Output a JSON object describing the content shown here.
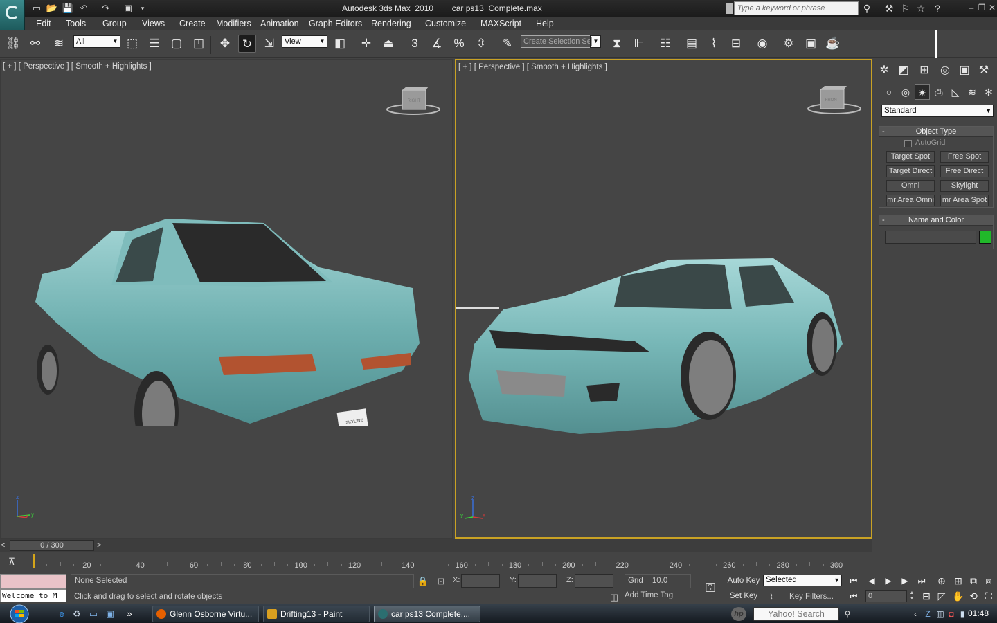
{
  "window": {
    "title": "Autodesk 3ds Max  2010        car ps13  Complete.max",
    "search_placeholder": "Type a keyword or phrase"
  },
  "menu": {
    "items": [
      "Edit",
      "Tools",
      "Group",
      "Views",
      "Create",
      "Modifiers",
      "Animation",
      "Graph Editors",
      "Rendering",
      "Customize",
      "MAXScript",
      "Help"
    ]
  },
  "toolbar": {
    "filter_value": "All",
    "coord_system_value": "View",
    "selection_set_placeholder": "Create Selection Se",
    "snap_label": "3"
  },
  "viewports": {
    "left_label": "[ + ] [ Perspective ] [ Smooth + Highlights ]",
    "right_label": "[ + ] [ Perspective ] [ Smooth + Highlights ]",
    "cube_face_left": "RIGHT",
    "cube_face_right": "FRONT",
    "axis_z": "z",
    "axis_x": "x",
    "axis_y": "y",
    "plate_top": "SKYLINE",
    "plate_number": "46-49"
  },
  "command_panel": {
    "category_value": "Standard",
    "object_type_title": "Object Type",
    "autogrid_label": "AutoGrid",
    "buttons": [
      "Target Spot",
      "Free Spot",
      "Target Direct",
      "Free Direct",
      "Omni",
      "Skylight",
      "mr Area Omni",
      "mr Area Spot"
    ],
    "name_color_title": "Name and Color",
    "rollout_minus": "-",
    "object_color": "#21b92a"
  },
  "timeline": {
    "frame_display": "0 / 300",
    "prev": "<",
    "next": ">",
    "ticks": [
      "20",
      "40",
      "60",
      "80",
      "100",
      "120",
      "140",
      "160",
      "180",
      "200",
      "220",
      "240",
      "260",
      "280",
      "300"
    ],
    "current_frame": 0,
    "total_frames": 300
  },
  "status": {
    "maxscript_output": "Welcome to M",
    "selection": "None Selected",
    "prompt": "Click and drag to select and rotate objects",
    "x_label": "X:",
    "y_label": "Y:",
    "z_label": "Z:",
    "grid": "Grid = 10.0",
    "add_time_tag": "Add Time Tag",
    "auto_key": "Auto Key",
    "set_key": "Set Key",
    "key_mode_value": "Selected",
    "key_filters": "Key Filters...",
    "frame_value": "0"
  },
  "taskbar": {
    "items": [
      "Glenn Osborne Virtu...",
      "Drifting13 - Paint",
      "car ps13  Complete...."
    ],
    "search": "Yahoo! Search",
    "hp": "hp",
    "clock": "01:48",
    "show_more": "»"
  },
  "colors": {
    "car_body": "#7fbcbc",
    "active_viewport_border": "#c9a224",
    "time_cursor": "#d4a51a"
  }
}
